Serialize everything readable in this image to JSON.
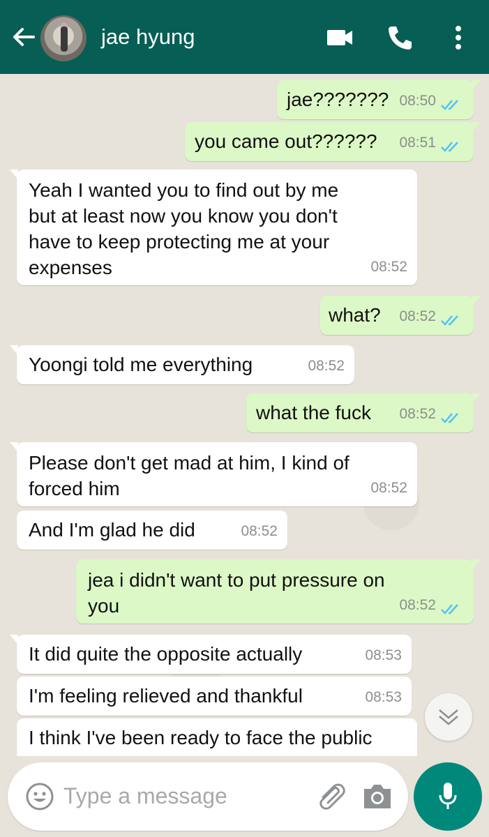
{
  "header": {
    "contact_name": "jae hyung",
    "icons": [
      "back-arrow-icon",
      "video-call-icon",
      "voice-call-icon",
      "more-options-icon"
    ],
    "bg_color": "#075e54"
  },
  "messages": [
    {
      "dir": "out",
      "text": "jae???????",
      "time": "08:50"
    },
    {
      "dir": "out",
      "text": "you came out??????",
      "time": "08:51"
    },
    {
      "dir": "in",
      "text": "Yeah I wanted you to find out by me\nbut at least now you know you don't\nhave to keep protecting me at your\nexpenses",
      "time": "08:52"
    },
    {
      "dir": "out",
      "text": "what?",
      "time": "08:52"
    },
    {
      "dir": "in",
      "text": "Yoongi told me everything",
      "time": "08:52"
    },
    {
      "dir": "out",
      "text": "what the fuck",
      "time": "08:52"
    },
    {
      "dir": "in",
      "text": "Please don't get mad at him, I kind of\nforced him",
      "time": "08:52"
    },
    {
      "dir": "in",
      "text": "And I'm glad he did",
      "time": "08:52"
    },
    {
      "dir": "out",
      "text": "jea i didn't want to put pressure on\nyou",
      "time": "08:52"
    },
    {
      "dir": "in",
      "text": "It did quite the opposite actually",
      "time": "08:53"
    },
    {
      "dir": "in",
      "text": "I'm feeling relieved and thankful",
      "time": "08:53"
    },
    {
      "dir": "in",
      "text": "I think I've been ready to face the public",
      "time": ""
    }
  ],
  "composer": {
    "placeholder": "Type a message",
    "icons": [
      "emoji-icon",
      "attach-icon",
      "camera-icon",
      "mic-icon"
    ]
  },
  "colors": {
    "outgoing_bubble": "#dcf8c6",
    "incoming_bubble": "#ffffff",
    "read_ticks": "#4fc3f7",
    "mic_button": "#00897b"
  }
}
